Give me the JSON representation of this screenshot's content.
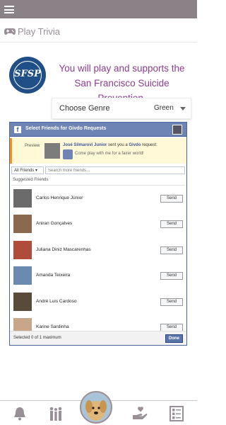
{
  "header": {
    "title": "Play Trivia"
  },
  "cause": {
    "logo_text": "SFSP",
    "tagline": "You will play and supports the San Francisco Suicide Prevention."
  },
  "genre": {
    "label": "Choose Genre",
    "value": "Green"
  },
  "fb_dialog": {
    "title": "Select Friends for Givdo Requests",
    "preview_label": "Preview",
    "preview_sender": "José Silmarovi Junior",
    "preview_middle": " sent you a ",
    "preview_app": "Givdo",
    "preview_suffix": " request:",
    "preview_message": "Come play with me for a fairer world!",
    "filter_label": "All Friends ▾",
    "search_placeholder": "Search more friends...",
    "suggested_label": "Suggested Friends",
    "send_label": "Send",
    "friends": [
      {
        "name": "Carlos Henrique Júnior",
        "color": "#6b6b6b"
      },
      {
        "name": "Aniran Gonçalves",
        "color": "#8a6a4e"
      },
      {
        "name": "Juliana Diniz Mascarenhas",
        "color": "#b04c3a"
      },
      {
        "name": "Amanda Teixeira",
        "color": "#6a8ab0"
      },
      {
        "name": "André Luis Cardoso",
        "color": "#5a4a3a"
      },
      {
        "name": "Karine Sardinha",
        "color": "#c8a68a"
      }
    ],
    "selected_text": "Selected 0 of 1 maximum",
    "done_label": "Done"
  },
  "bottom_nav": {
    "items": [
      "bell-icon",
      "family-icon",
      "dog-avatar",
      "heart-hand-icon",
      "checklist-icon"
    ]
  },
  "colors": {
    "accent": "#8d3d8f",
    "top_bar": "#8a8287",
    "fb_blue": "#6d84b4"
  }
}
